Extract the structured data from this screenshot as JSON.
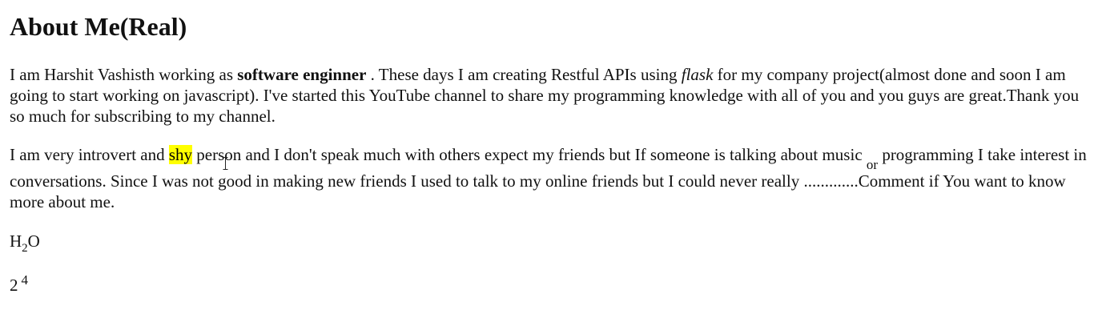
{
  "heading": "About Me(Real)",
  "paragraph1": {
    "before_bold": "I am Harshit Vashisth working as ",
    "bold": "software enginner",
    "after_bold": " . These days I am creating Restful APIs using ",
    "italic": "flask",
    "rest": " for my company project(almost done and soon I am going to start working on javascript). I've started this YouTube channel to share my programming knowledge with all of you and you guys are great.Thank you so much for subscribing to my channel."
  },
  "paragraph2": {
    "before_highlight": "I am very introvert and ",
    "highlight": "shy",
    "after_highlight": " person and I don't speak much with others expect my friends but If someone is talking about music ",
    "subscript_word": "or",
    "rest": " programming I take interest in conversations. Since I was not good in making new friends I used to talk to my online friends but I could never really .............Comment if You want to know more about me."
  },
  "formula_h2o": {
    "base": "H",
    "subscript": "2",
    "tail": "O"
  },
  "formula_power": {
    "base": "2",
    "superscript": "4"
  },
  "colors": {
    "highlight": "#ffff00"
  },
  "icons": {
    "cursor": "text-cursor-icon"
  }
}
